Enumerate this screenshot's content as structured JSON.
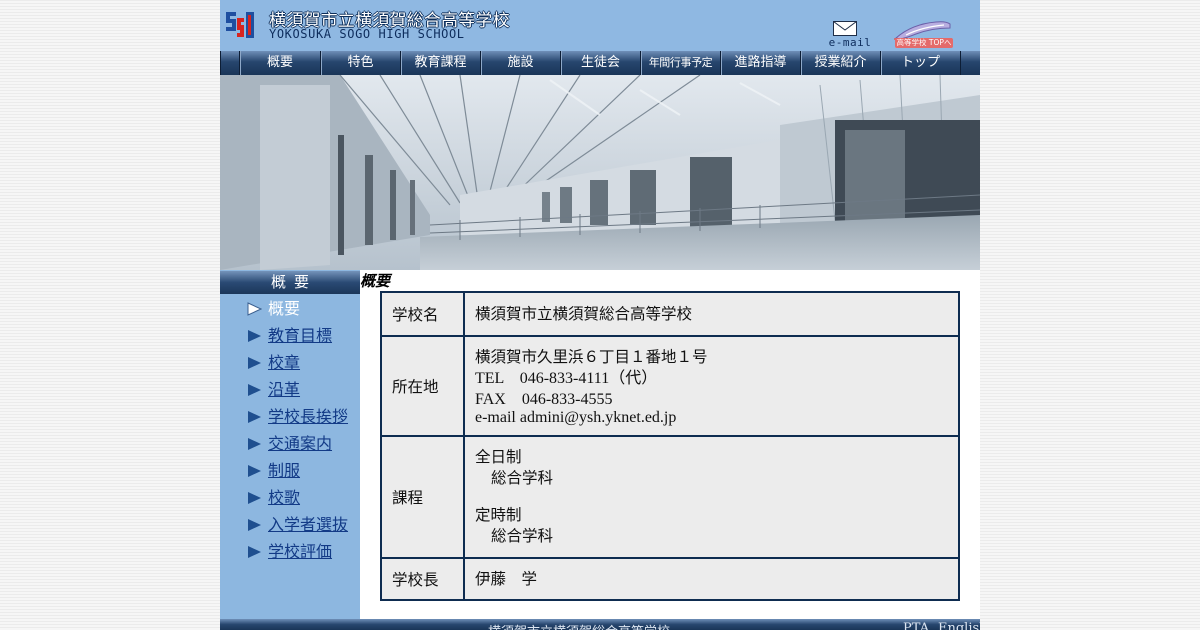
{
  "header": {
    "title_jp": "横須賀市立横須賀総合高等学校",
    "title_en": "YOKOSUKA SOGO HIGH SCHOOL",
    "email_label": "e-mail",
    "hs_top_label": "高等学校 TOPへ",
    "brand_color": "#8fb8e2",
    "nav_color": "#27466e"
  },
  "nav": {
    "items": [
      {
        "label": "概要"
      },
      {
        "label": "特色"
      },
      {
        "label": "教育課程"
      },
      {
        "label": "施設"
      },
      {
        "label": "生徒会"
      },
      {
        "label": "年間行事予定"
      },
      {
        "label": "進路指導"
      },
      {
        "label": "授業紹介"
      },
      {
        "label": "トップ"
      }
    ]
  },
  "sidebar": {
    "heading": "概要",
    "items": [
      {
        "label": "概要",
        "current": true
      },
      {
        "label": "教育目標"
      },
      {
        "label": "校章"
      },
      {
        "label": "沿革"
      },
      {
        "label": "学校長挨拶"
      },
      {
        "label": "交通案内"
      },
      {
        "label": "制服"
      },
      {
        "label": "校歌"
      },
      {
        "label": "入学者選抜"
      },
      {
        "label": "学校評価"
      }
    ]
  },
  "main": {
    "heading": "概要",
    "table": {
      "school_name_label": "学校名",
      "school_name": "横須賀市立横須賀総合高等学校",
      "location_label": "所在地",
      "address": "横須賀市久里浜６丁目１番地１号",
      "tel": "TEL　046-833-4111（代）",
      "fax": "FAX　046-833-4555",
      "email": "e-mail admini@ysh.yknet.ed.jp",
      "course_label": "課程",
      "course1_name": "全日制",
      "course1_dept": "総合学科",
      "course2_name": "定時制",
      "course2_dept": "総合学科",
      "principal_label": "学校長",
      "principal": "伊藤　学"
    }
  },
  "footer": {
    "name": "横須賀市立横須賀総合高等学校",
    "pta": "PTA",
    "english": "English"
  }
}
